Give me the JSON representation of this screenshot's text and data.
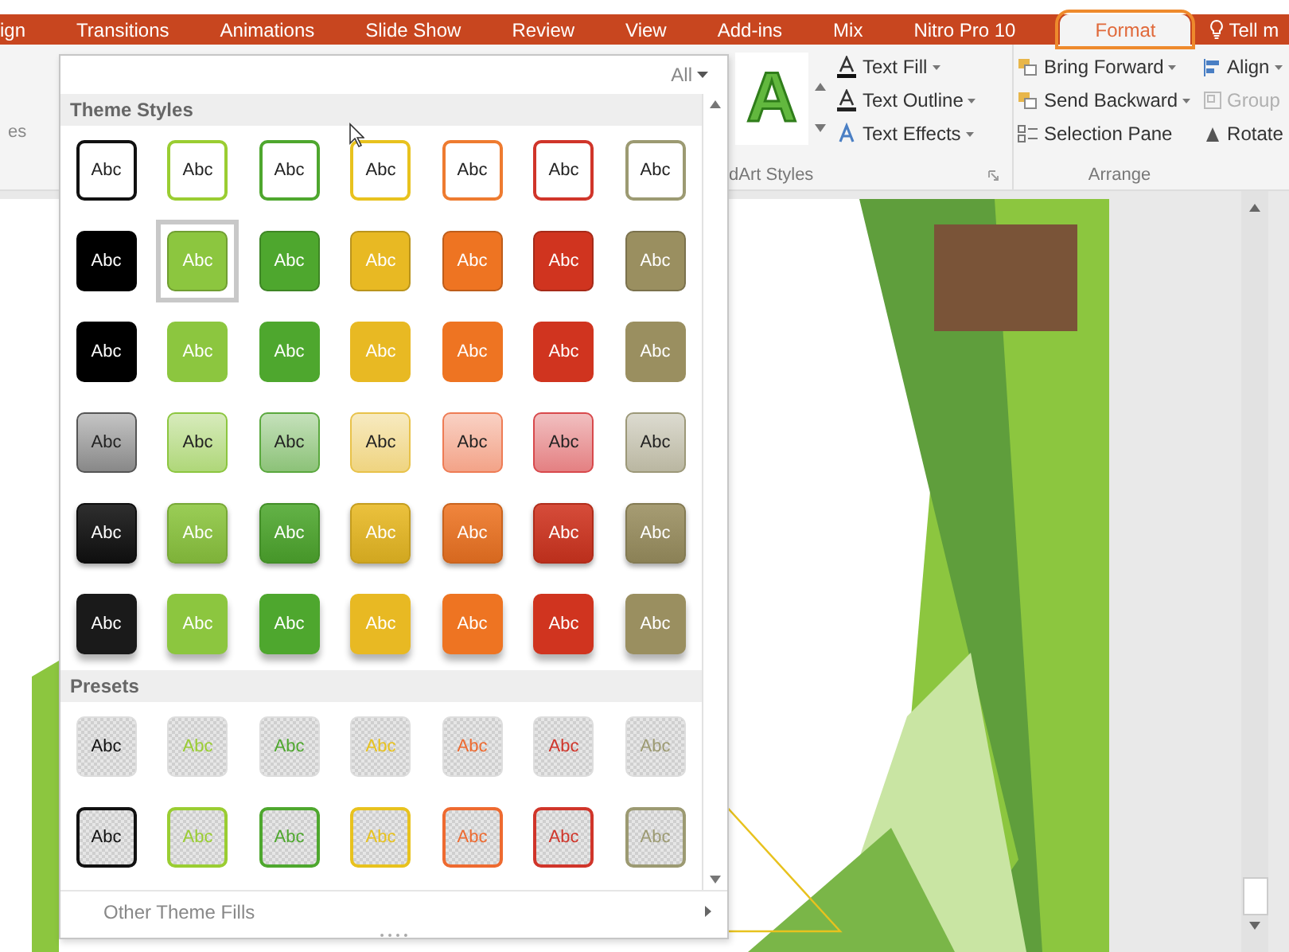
{
  "ribbon_tabs": [
    {
      "label": "ign",
      "selected": false
    },
    {
      "label": "Transitions",
      "selected": false
    },
    {
      "label": "Animations",
      "selected": false
    },
    {
      "label": "Slide Show",
      "selected": false
    },
    {
      "label": "Review",
      "selected": false
    },
    {
      "label": "View",
      "selected": false
    },
    {
      "label": "Add-ins",
      "selected": false
    },
    {
      "label": "Mix",
      "selected": false
    },
    {
      "label": "Nitro Pro 10",
      "selected": false
    },
    {
      "label": "Format",
      "selected": true
    }
  ],
  "tell_me": {
    "label": "Tell m"
  },
  "ribbon": {
    "left_group_label": "es",
    "wordart_styles": {
      "label": "dArt Styles",
      "preview": "A",
      "commands": [
        {
          "label": "Text Fill",
          "kind": "fill"
        },
        {
          "label": "Text Outline",
          "kind": "outline"
        },
        {
          "label": "Text Effects",
          "kind": "effects"
        }
      ]
    },
    "arrange": {
      "label": "Arrange",
      "commands": [
        {
          "label": "Bring Forward",
          "kind": "forward",
          "disabled": false,
          "dropdown": true
        },
        {
          "label": "Send Backward",
          "kind": "backward",
          "disabled": false,
          "dropdown": true
        },
        {
          "label": "Selection Pane",
          "kind": "pane",
          "disabled": false,
          "dropdown": false
        }
      ],
      "commands_2": [
        {
          "label": "Align",
          "kind": "align",
          "disabled": false,
          "dropdown": true
        },
        {
          "label": "Group",
          "kind": "group",
          "disabled": true,
          "dropdown": false
        },
        {
          "label": "Rotate",
          "kind": "rotate",
          "disabled": false,
          "dropdown": false
        }
      ]
    }
  },
  "gallery": {
    "filter": "All",
    "sections": [
      {
        "title": "Theme Styles",
        "rows": [
          {
            "kind": "outline",
            "swatches": [
              {
                "label": "Abc",
                "color": "#111111",
                "selected": false
              },
              {
                "label": "Abc",
                "color": "#9acd32",
                "selected": false
              },
              {
                "label": "Abc",
                "color": "#4ea72e",
                "selected": false
              },
              {
                "label": "Abc",
                "color": "#e8c21e",
                "selected": false
              },
              {
                "label": "Abc",
                "color": "#ee7b30",
                "selected": false
              },
              {
                "label": "Abc",
                "color": "#d0352a",
                "selected": false
              },
              {
                "label": "Abc",
                "color": "#9c9a72",
                "selected": false
              }
            ]
          },
          {
            "kind": "solid",
            "swatches": [
              {
                "label": "Abc",
                "color": "#000000",
                "selected": false
              },
              {
                "label": "Abc",
                "color": "#8cc63f",
                "selected": true
              },
              {
                "label": "Abc",
                "color": "#4ea72e",
                "selected": false
              },
              {
                "label": "Abc",
                "color": "#e8b923",
                "selected": false
              },
              {
                "label": "Abc",
                "color": "#ee7422",
                "selected": false
              },
              {
                "label": "Abc",
                "color": "#d0341f",
                "selected": false
              },
              {
                "label": "Abc",
                "color": "#9a8f60",
                "selected": false
              }
            ]
          },
          {
            "kind": "flat",
            "swatches": [
              {
                "label": "Abc",
                "color": "#000000",
                "selected": false
              },
              {
                "label": "Abc",
                "color": "#8cc63f",
                "selected": false
              },
              {
                "label": "Abc",
                "color": "#4ea72e",
                "selected": false
              },
              {
                "label": "Abc",
                "color": "#e8b923",
                "selected": false
              },
              {
                "label": "Abc",
                "color": "#ee7422",
                "selected": false
              },
              {
                "label": "Abc",
                "color": "#d0341f",
                "selected": false
              },
              {
                "label": "Abc",
                "color": "#9a8f60",
                "selected": false
              }
            ]
          },
          {
            "kind": "light",
            "swatches": [
              {
                "label": "Abc",
                "color": "#555555",
                "selected": false
              },
              {
                "label": "Abc",
                "color": "#8cc63f",
                "selected": false
              },
              {
                "label": "Abc",
                "color": "#5aa83e",
                "selected": false
              },
              {
                "label": "Abc",
                "color": "#e8c24a",
                "selected": false
              },
              {
                "label": "Abc",
                "color": "#ee7c55",
                "selected": false
              },
              {
                "label": "Abc",
                "color": "#d8494c",
                "selected": false
              },
              {
                "label": "Abc",
                "color": "#9c9878",
                "selected": false
              }
            ]
          },
          {
            "kind": "raised",
            "swatches": [
              {
                "label": "Abc",
                "color": "#111111",
                "selected": false
              },
              {
                "label": "Abc",
                "color": "#8cc63f",
                "selected": false
              },
              {
                "label": "Abc",
                "color": "#4ea72e",
                "selected": false
              },
              {
                "label": "Abc",
                "color": "#e8b923",
                "selected": false
              },
              {
                "label": "Abc",
                "color": "#ee7422",
                "selected": false
              },
              {
                "label": "Abc",
                "color": "#d0341f",
                "selected": false
              },
              {
                "label": "Abc",
                "color": "#9a8f60",
                "selected": false
              }
            ]
          },
          {
            "kind": "shadow",
            "swatches": [
              {
                "label": "Abc",
                "color": "#1a1a1a",
                "selected": false
              },
              {
                "label": "Abc",
                "color": "#8cc63f",
                "selected": false
              },
              {
                "label": "Abc",
                "color": "#4ea72e",
                "selected": false
              },
              {
                "label": "Abc",
                "color": "#e8b923",
                "selected": false
              },
              {
                "label": "Abc",
                "color": "#ee7422",
                "selected": false
              },
              {
                "label": "Abc",
                "color": "#d0341f",
                "selected": false
              },
              {
                "label": "Abc",
                "color": "#9a8f60",
                "selected": false
              }
            ]
          }
        ]
      },
      {
        "title": "Presets",
        "rows": [
          {
            "kind": "preset_plain",
            "swatches": [
              {
                "label": "Abc",
                "color": "#111111",
                "selected": false
              },
              {
                "label": "Abc",
                "color": "#9acd32",
                "selected": false
              },
              {
                "label": "Abc",
                "color": "#4ea72e",
                "selected": false
              },
              {
                "label": "Abc",
                "color": "#e8c21e",
                "selected": false
              },
              {
                "label": "Abc",
                "color": "#ee6a30",
                "selected": false
              },
              {
                "label": "Abc",
                "color": "#d0352a",
                "selected": false
              },
              {
                "label": "Abc",
                "color": "#9c9a72",
                "selected": false
              }
            ]
          },
          {
            "kind": "preset_outline",
            "swatches": [
              {
                "label": "Abc",
                "color": "#111111",
                "selected": false
              },
              {
                "label": "Abc",
                "color": "#9acd32",
                "selected": false
              },
              {
                "label": "Abc",
                "color": "#4ea72e",
                "selected": false
              },
              {
                "label": "Abc",
                "color": "#e8c21e",
                "selected": false
              },
              {
                "label": "Abc",
                "color": "#ee6a30",
                "selected": false
              },
              {
                "label": "Abc",
                "color": "#d0352a",
                "selected": false
              },
              {
                "label": "Abc",
                "color": "#9c9a72",
                "selected": false
              }
            ]
          }
        ]
      }
    ],
    "footer": "Other Theme Fills"
  }
}
